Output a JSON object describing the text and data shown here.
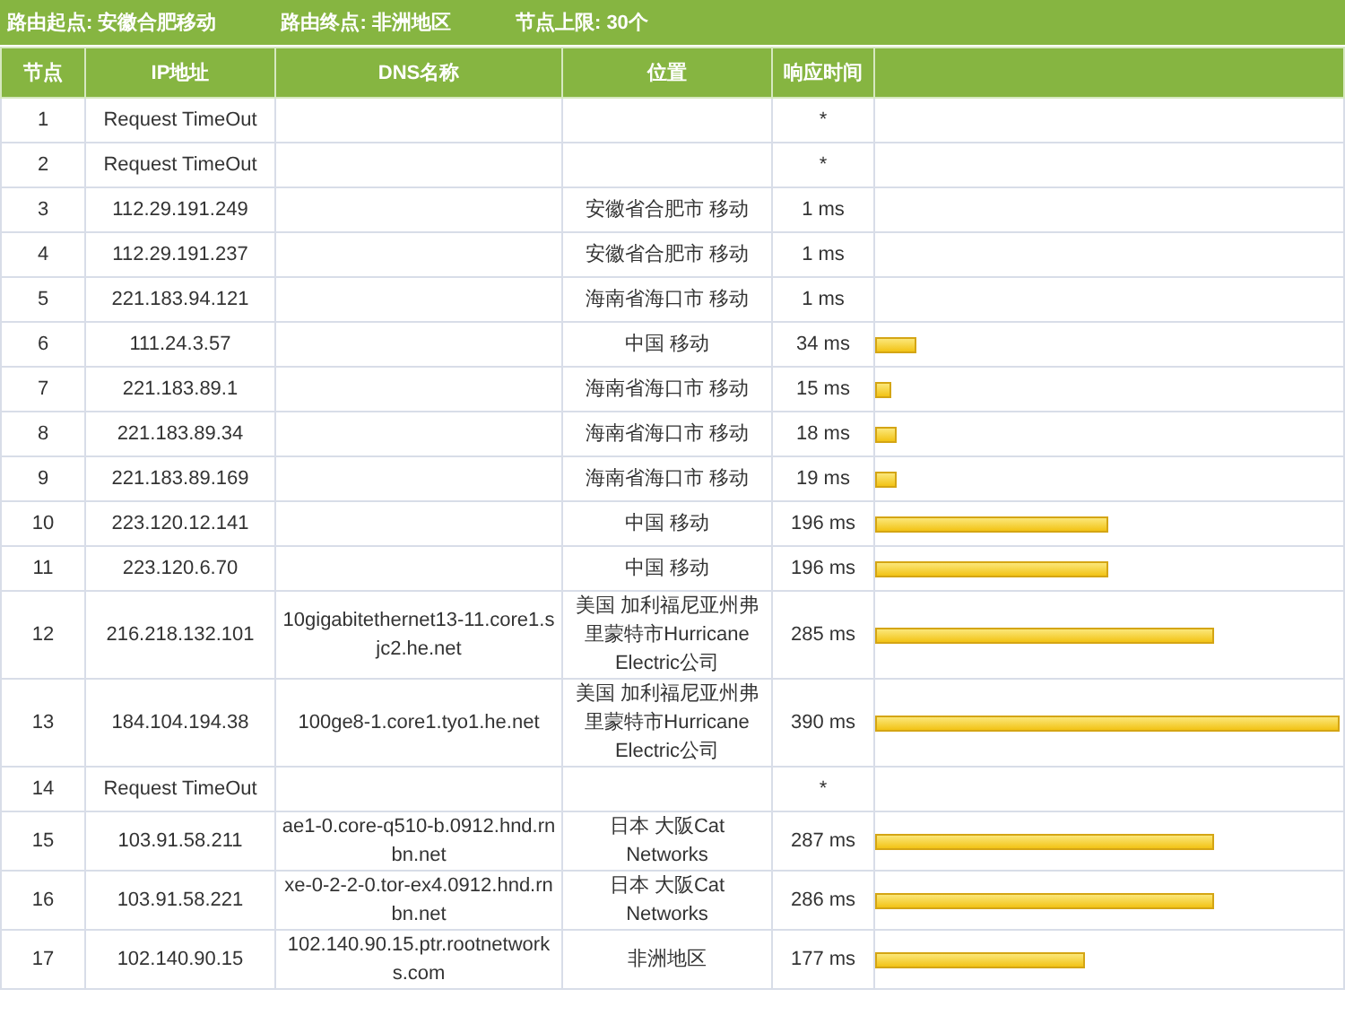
{
  "route_info": [
    {
      "label": "路由起点:",
      "value": "安徽合肥移动"
    },
    {
      "label": "路由终点:",
      "value": "非洲地区"
    },
    {
      "label": "节点上限:",
      "value": "30个"
    }
  ],
  "table": {
    "columns": [
      "节点",
      "IP地址",
      "DNS名称",
      "位置",
      "响应时间"
    ],
    "rows": [
      {
        "hop": "1",
        "ip": "Request TimeOut",
        "time": "*"
      },
      {
        "hop": "2",
        "ip": "Request TimeOut",
        "time": "*"
      },
      {
        "hop": "3",
        "ip": "112.29.191.249",
        "location": "安徽省合肥市 移动",
        "time": "1 ms"
      },
      {
        "hop": "4",
        "ip": "112.29.191.237",
        "location": "安徽省合肥市 移动",
        "time": "1 ms"
      },
      {
        "hop": "5",
        "ip": "221.183.94.121",
        "location": "海南省海口市 移动",
        "time": "1 ms"
      },
      {
        "hop": "6",
        "ip": "111.24.3.57",
        "location": "中国 移动",
        "time": "34 ms",
        "level": 0.09
      },
      {
        "hop": "7",
        "ip": "221.183.89.1",
        "location": "海南省海口市 移动",
        "time": "15 ms",
        "level": 0.035
      },
      {
        "hop": "8",
        "ip": "221.183.89.34",
        "location": "海南省海口市 移动",
        "time": "18 ms",
        "level": 0.045
      },
      {
        "hop": "9",
        "ip": "221.183.89.169",
        "location": "海南省海口市 移动",
        "time": "19 ms",
        "level": 0.045
      },
      {
        "hop": "10",
        "ip": "223.120.12.141",
        "location": "中国 移动",
        "time": "196 ms",
        "level": 0.5
      },
      {
        "hop": "11",
        "ip": "223.120.6.70",
        "location": "中国 移动",
        "time": "196 ms",
        "level": 0.5
      },
      {
        "hop": "12",
        "ip": "216.218.132.101",
        "dns": "10gigabitethernet13-11.core1.sjc2.he.net",
        "location": "美国 加利福尼亚州弗里蒙特市Hurricane Electric公司",
        "time": "285 ms",
        "level": 0.73
      },
      {
        "hop": "13",
        "ip": "184.104.194.38",
        "dns": "100ge8-1.core1.tyo1.he.net",
        "location": "美国 加利福尼亚州弗里蒙特市Hurricane Electric公司",
        "time": "390 ms",
        "level": 1
      },
      {
        "hop": "14",
        "ip": "Request TimeOut",
        "time": "*"
      },
      {
        "hop": "15",
        "ip": "103.91.58.211",
        "dns": "ae1-0.core-q510-b.0912.hnd.rnbn.net",
        "location": "日本 大阪Cat Networks",
        "time": "287 ms",
        "level": 0.73
      },
      {
        "hop": "16",
        "ip": "103.91.58.221",
        "dns": "xe-0-2-2-0.tor-ex4.0912.hnd.rnbn.net",
        "location": "日本 大阪Cat Networks",
        "time": "286 ms",
        "level": 0.73
      },
      {
        "hop": "17",
        "ip": "102.140.90.15",
        "dns": "102.140.90.15.ptr.rootnetworks.com",
        "location": "非洲地区",
        "time": "177 ms",
        "level": 0.45
      }
    ]
  }
}
